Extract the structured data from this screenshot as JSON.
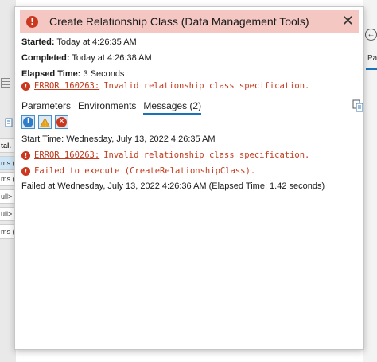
{
  "background": {
    "left_cells": [
      "tal.",
      "ms (",
      "ms (",
      "ull>",
      "ull>",
      "ms ("
    ],
    "right_tab_label": "Pa",
    "right_back_glyph": "←"
  },
  "popup": {
    "title": "Create Relationship Class (Data Management Tools)",
    "close_glyph": "✕",
    "started_label": "Started:",
    "started_value": "Today at 4:26:35 AM",
    "completed_label": "Completed:",
    "completed_value": "Today at 4:26:38 AM",
    "elapsed_label": "Elapsed Time:",
    "elapsed_value": "3 Seconds",
    "summary_error": {
      "code": "ERROR 160263:",
      "text": "Invalid relationship class specification."
    },
    "tabs": [
      {
        "label": "Parameters"
      },
      {
        "label": "Environments"
      },
      {
        "label": "Messages (2)"
      }
    ],
    "filters": [
      "info-icon",
      "warning-icon",
      "error-icon"
    ],
    "messages": {
      "start": "Start Time: Wednesday, July 13, 2022 4:26:35 AM",
      "error1_code": "ERROR 160263:",
      "error1_text": "Invalid relationship class specification.",
      "error2_text": "Failed to execute (CreateRelationshipClass).",
      "failed": "Failed at Wednesday, July 13, 2022 4:26:36 AM (Elapsed Time: 1.42 seconds)"
    }
  },
  "colors": {
    "header_bg": "#f4c7c3",
    "error_red": "#c9381f",
    "accent_blue": "#1a73b8",
    "warning_orange": "#e8a317"
  }
}
